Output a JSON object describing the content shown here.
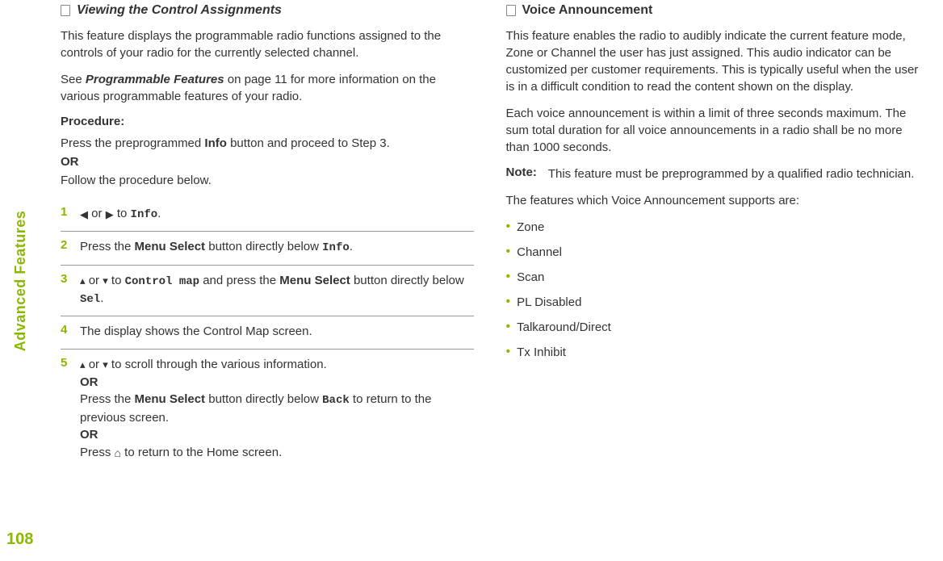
{
  "side_label": "Advanced Features",
  "page_number": "108",
  "left": {
    "heading": "Viewing the Control Assignments",
    "intro": "This feature displays the programmable radio functions assigned to the controls of your radio for the currently selected channel.",
    "see_pre": "See ",
    "see_bold": "Programmable Features",
    "see_post": " on page 11 for more information on the various programmable features of your radio.",
    "procedure_label": "Procedure:",
    "proc_intro_pre": "Press the preprogrammed ",
    "proc_intro_bold": "Info",
    "proc_intro_post": " button and proceed to Step 3.",
    "or": "OR",
    "proc_intro_follow": "Follow the procedure below.",
    "steps": {
      "s1": {
        "num": "1",
        "or_text": " or ",
        "to_text": " to ",
        "target": "Info",
        "period": "."
      },
      "s2": {
        "num": "2",
        "pre": "Press the ",
        "bold": "Menu Select",
        "mid": " button directly below ",
        "target": "Info",
        "period": "."
      },
      "s3": {
        "num": "3",
        "or_text": " or ",
        "to_text": " to ",
        "target": "Control map",
        "mid": " and press the ",
        "bold": "Menu Select",
        "post": " button directly below ",
        "sel": "Sel",
        "period": "."
      },
      "s4": {
        "num": "4",
        "text": "The display shows the Control Map screen."
      },
      "s5": {
        "num": "5",
        "or_text": " or ",
        "scroll": " to scroll through the various information.",
        "or": "OR",
        "line2_pre": "Press the ",
        "line2_bold": "Menu Select",
        "line2_mid": " button directly below ",
        "line2_back": "Back",
        "line2_post": " to return to the previous screen.",
        "or2": "OR",
        "line3_pre": "Press ",
        "line3_post": " to return to the Home screen."
      }
    }
  },
  "right": {
    "heading": "Voice Announcement",
    "p1": "This feature enables the radio to audibly indicate the current feature mode, Zone or Channel the user has just assigned. This audio indicator can be customized per customer requirements. This is typically useful when the user is in a difficult condition to read the content shown on the display.",
    "p2": "Each voice announcement is within a limit of three seconds maximum. The sum total duration for all voice announcements in a radio shall be no more than 1000 seconds.",
    "note_label": "Note:",
    "note_text": "This feature must be preprogrammed by a qualified radio technician.",
    "supports_intro": "The features which Voice Announcement supports are:",
    "bullets": {
      "b1": "Zone",
      "b2": "Channel",
      "b3": "Scan",
      "b4": "PL Disabled",
      "b5": "Talkaround/Direct",
      "b6": "Tx Inhibit"
    }
  }
}
